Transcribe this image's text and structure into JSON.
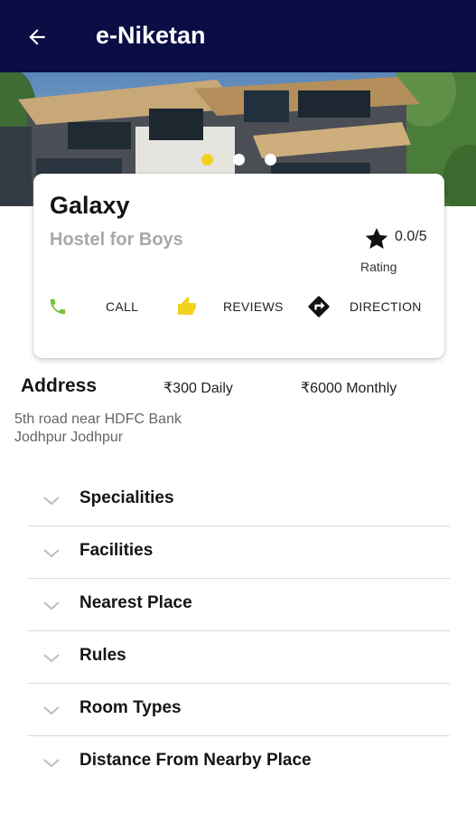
{
  "appbar": {
    "title": "e-Niketan",
    "back_icon": "arrow-left-icon",
    "background": "#0b0d45"
  },
  "hero": {
    "slide_count": 3,
    "active_slide": 1,
    "active_dot_color": "#f2d11f"
  },
  "hostel": {
    "name": "Galaxy",
    "type": "Hostel for Boys",
    "rating_value": "0.0/5",
    "rating_label": "Rating"
  },
  "actions": [
    {
      "label": "CALL",
      "icon": "phone-icon",
      "color": "#7ac142"
    },
    {
      "label": "REVIEWS",
      "icon": "thumbs-up-icon",
      "color": "#f2d11f"
    },
    {
      "label": "DIRECTION",
      "icon": "direction-icon",
      "color": "#111111"
    }
  ],
  "address": {
    "title": "Address",
    "daily_price": "₹300 Daily",
    "monthly_price": "₹6000 Monthly",
    "line1": "5th road near HDFC Bank",
    "line2": "Jodhpur Jodhpur"
  },
  "sections": [
    {
      "label": "Specialities"
    },
    {
      "label": "Facilities"
    },
    {
      "label": "Nearest Place"
    },
    {
      "label": "Rules"
    },
    {
      "label": "Room Types"
    },
    {
      "label": "Distance From Nearby Place"
    }
  ]
}
